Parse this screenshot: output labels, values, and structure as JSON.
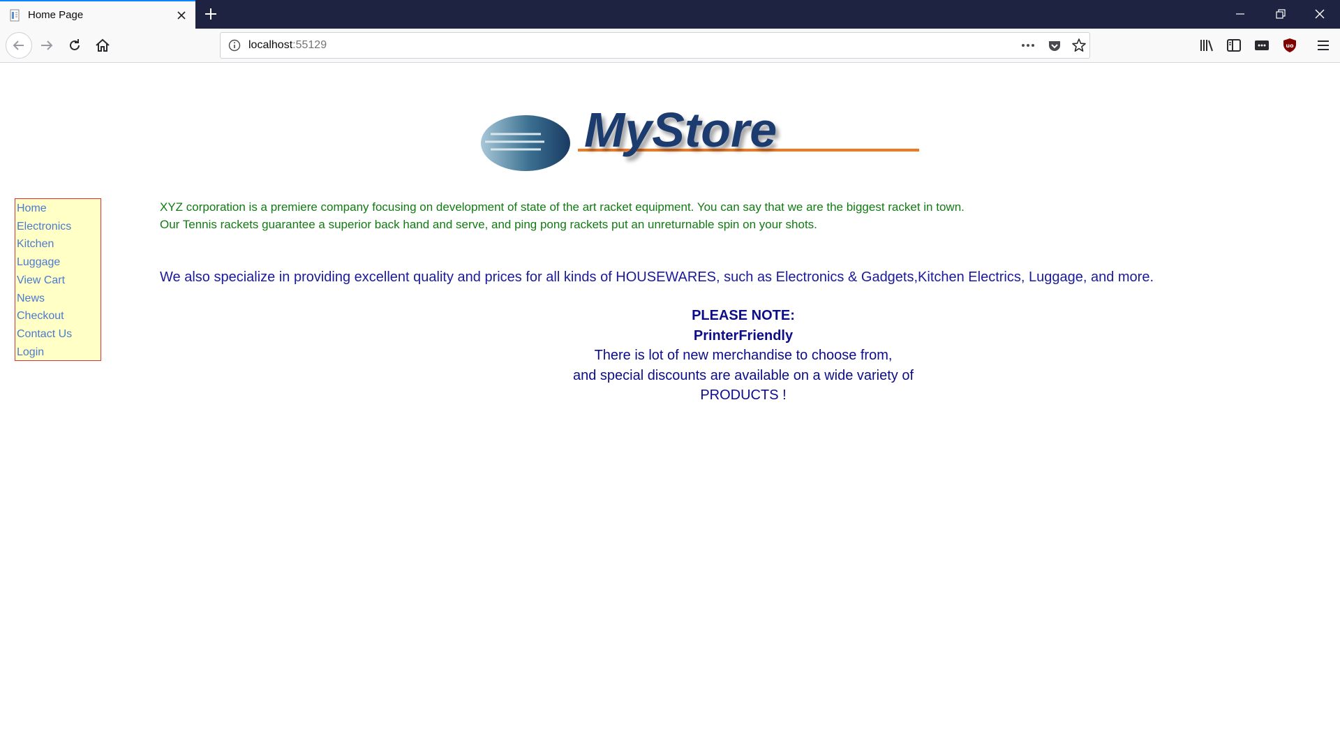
{
  "browser": {
    "tab_title": "Home Page",
    "url_host": "localhost",
    "url_port": ":55129"
  },
  "sidebar": {
    "items": [
      {
        "label": "Home"
      },
      {
        "label": "Electronics"
      },
      {
        "label": "Kitchen"
      },
      {
        "label": "Luggage"
      },
      {
        "label": "View Cart"
      },
      {
        "label": "News"
      },
      {
        "label": "Checkout"
      },
      {
        "label": "Contact Us"
      },
      {
        "label": "Login"
      }
    ]
  },
  "logo": {
    "text": "MyStore"
  },
  "content": {
    "intro_line1": "XYZ corporation is a premiere company focusing on development of state of the art racket equipment. You can say that we are the biggest racket in town.",
    "intro_line2": "Our Tennis rackets guarantee a superior back hand and serve, and ping pong rackets put an unreturnable spin on your shots.",
    "special": "We also specialize in providing excellent quality and prices for all kinds of HOUSEWARES, such as Electronics & Gadgets,Kitchen Electrics, Luggage, and more.",
    "note_heading": "PLEASE NOTE:",
    "note_subheading": "PrinterFriendly",
    "note_line1": "There is lot of new merchandise to choose from,",
    "note_line2": "and special discounts are available on a wide variety of",
    "note_line3": "PRODUCTS !"
  },
  "colors": {
    "titlebar": "#1d2340",
    "sidebar_bg": "#ffffc6",
    "sidebar_border": "#e03030",
    "link": "#4a7ad0",
    "intro_text": "#127a12",
    "special_text": "#1a1a9a",
    "logo_underline": "#f07820"
  },
  "icons": [
    "page-icon",
    "close-icon",
    "plus-icon",
    "minimize-icon",
    "restore-icon",
    "window-close-icon",
    "back-arrow-icon",
    "forward-arrow-icon",
    "reload-icon",
    "home-icon",
    "info-icon",
    "more-dots-icon",
    "pocket-icon",
    "star-icon",
    "library-icon",
    "sidebar-icon",
    "extension-icon",
    "ublock-icon",
    "hamburger-menu-icon"
  ]
}
